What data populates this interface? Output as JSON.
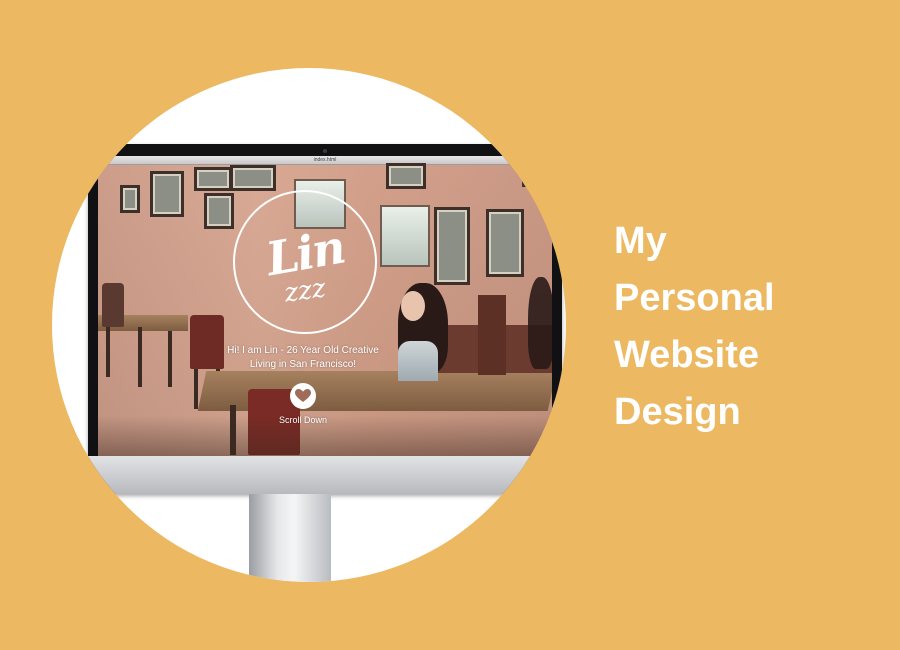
{
  "colors": {
    "background": "#ecb862",
    "circle": "#ffffff",
    "headline": "#ffffff"
  },
  "monitor": {
    "window_title": "index.html",
    "site": {
      "logo_primary": "Lin",
      "logo_secondary": "zzz",
      "hero_line_1": "Hi! I am Lin - 26 Year Old Creative",
      "hero_line_2": "Living in San Francisco!",
      "scroll_button_icon": "heart-icon",
      "scroll_label": "Scroll Down"
    }
  },
  "headline": {
    "lines": [
      "My",
      "Personal",
      "Website",
      "Design"
    ]
  }
}
